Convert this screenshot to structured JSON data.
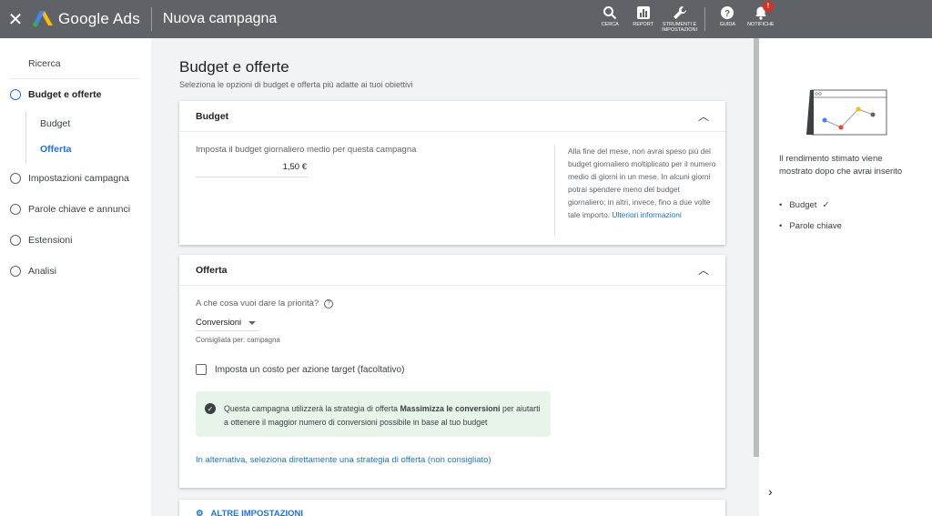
{
  "topbar": {
    "close_icon": "close-icon",
    "app_name": "Google Ads",
    "page_title": "Nuova campagna",
    "actions": [
      {
        "label": "CERCA",
        "icon": "search-icon"
      },
      {
        "label": "REPORT",
        "icon": "report-icon"
      },
      {
        "label": "STRUMENTI E IMPOSTAZIONI",
        "icon": "wrench-icon"
      },
      {
        "label": "GUIDA",
        "icon": "help-icon"
      },
      {
        "label": "NOTIFICHE",
        "icon": "bell-icon"
      }
    ],
    "notification_badge": "!"
  },
  "sidebar": {
    "items": [
      {
        "label": "Ricerca"
      },
      {
        "label": "Budget e offerte"
      },
      {
        "label": "Budget"
      },
      {
        "label": "Offerta"
      },
      {
        "label": "Impostazioni campagna"
      },
      {
        "label": "Parole chiave e annunci"
      },
      {
        "label": "Estensioni"
      },
      {
        "label": "Analisi"
      }
    ]
  },
  "main": {
    "title": "Budget e offerte",
    "subtitle": "Seleziona le opzioni di budget e offerta più adatte ai tuoi obiettivi",
    "budget": {
      "header": "Budget",
      "label": "Imposta il budget giornaliero medio per questa campagna",
      "value": "1,50 €",
      "help_text": "Alla fine del mese, non avrai speso più del budget giornaliero moltiplicato per il numero medio di giorni in un mese. In alcuni giorni potrai spendere meno del budget giornaliero; in altri, invece, fino a due volte tale importo.",
      "help_link": "Ulteriori informazioni"
    },
    "offer": {
      "header": "Offerta",
      "question": "A che cosa vuoi dare la priorità?",
      "selected": "Conversioni",
      "recommended": "Consigliata per: campagna",
      "checkbox_label": "Imposta un costo per azione target (facoltativo)",
      "info_prefix": "Questa campagna utilizzerà la strategia di offerta ",
      "info_bold": "Massimizza le conversioni",
      "info_suffix": " per aiutarti a ottenere il maggior numero di conversioni possibile in base al tuo budget",
      "alt_link": "In alternativa, seleziona direttamente una strategia di offerta (non consigliato)"
    },
    "more_settings": "ALTRE IMPOSTAZIONI"
  },
  "right_panel": {
    "text": "Il rendimento stimato viene mostrato dopo che avrai inserito",
    "bullets": [
      {
        "label": "Budget",
        "check": "✓"
      },
      {
        "label": "Parole chiave",
        "check": ""
      }
    ]
  },
  "colors": {
    "topbar": "#5f6368",
    "accent": "#1a73e8",
    "info_bg": "#e6f4ea"
  }
}
